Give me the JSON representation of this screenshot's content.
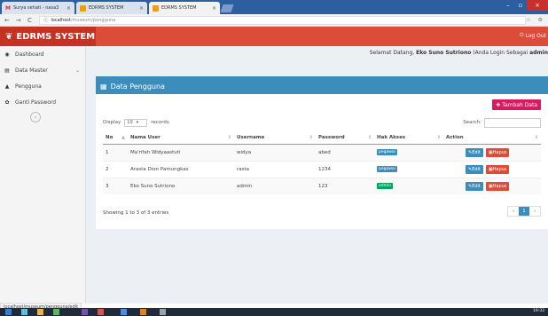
{
  "browser": {
    "tabs": [
      {
        "label": "Surya sehati - nasa3"
      },
      {
        "label": "EDRMS SYSTEM"
      },
      {
        "label": "EDRMS SYSTEM"
      }
    ],
    "url_host": "localhost",
    "url_path": "/museum/pengguna"
  },
  "header": {
    "brand": "EDRMS SYSTEM",
    "logout_label": "Log Out"
  },
  "sidebar": {
    "items": [
      {
        "label": "Dashboard"
      },
      {
        "label": "Data Master"
      },
      {
        "label": "Pengguna"
      },
      {
        "label": "Ganti Password"
      }
    ]
  },
  "welcome": {
    "prefix": "Selamat Datang,",
    "user": "Eko Suno Sutriono",
    "middle": "(Anda Login Sebagai",
    "role": "admin"
  },
  "panel": {
    "title": "Data Pengguna",
    "add_button": "Tambah Data",
    "display_label": "Display",
    "records_label": "records",
    "length_value": "10",
    "search_label": "Search:"
  },
  "table": {
    "headers": [
      "No",
      "Nama User",
      "Username",
      "Password",
      "Hak Akses",
      "Action"
    ],
    "rows": [
      {
        "no": "1",
        "nama": "Ma'rifah Widyaastuti",
        "username": "widya",
        "password": "abed",
        "hak": "pegawai"
      },
      {
        "no": "2",
        "nama": "Arasta Dion Pamungkas",
        "username": "rasta",
        "password": "1234",
        "hak": "pegawai"
      },
      {
        "no": "3",
        "nama": "Eko Suno Sutriono",
        "username": "admin",
        "password": "123",
        "hak": "admin"
      }
    ],
    "edit_label": "Edit",
    "hapus_label": "Hapus",
    "info": "Showing 1 to 3 of 3 entries",
    "page": "1"
  },
  "statusbar": "localhost/museum/pengguna/edit",
  "taskbar": {
    "time": "19:33"
  },
  "colors": {
    "header": "#dd4b39",
    "brand": "#c23321",
    "primary": "#3c8dbc",
    "add_button": "#d81b60",
    "danger": "#dd4b39",
    "admin_badge": "#00a65a"
  }
}
